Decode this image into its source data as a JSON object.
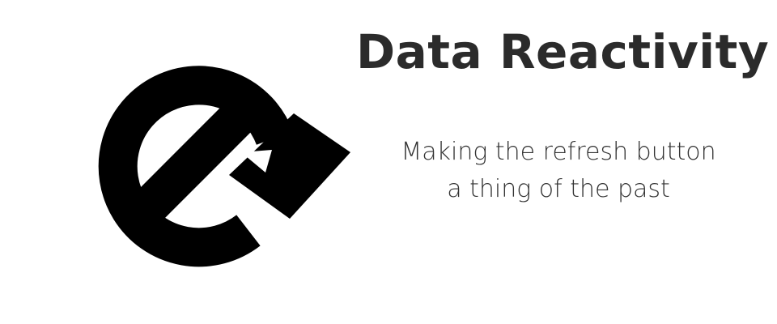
{
  "title": "Data Reactivity",
  "subtitle_lines": [
    "Making the refresh button",
    "a thing of the past"
  ],
  "logo": {
    "icon": "reactivity-refresh-icon",
    "color": "#000000"
  },
  "colors": {
    "background": "#ffffff",
    "title": "#2b2b2b",
    "subtitle": "#333333"
  }
}
